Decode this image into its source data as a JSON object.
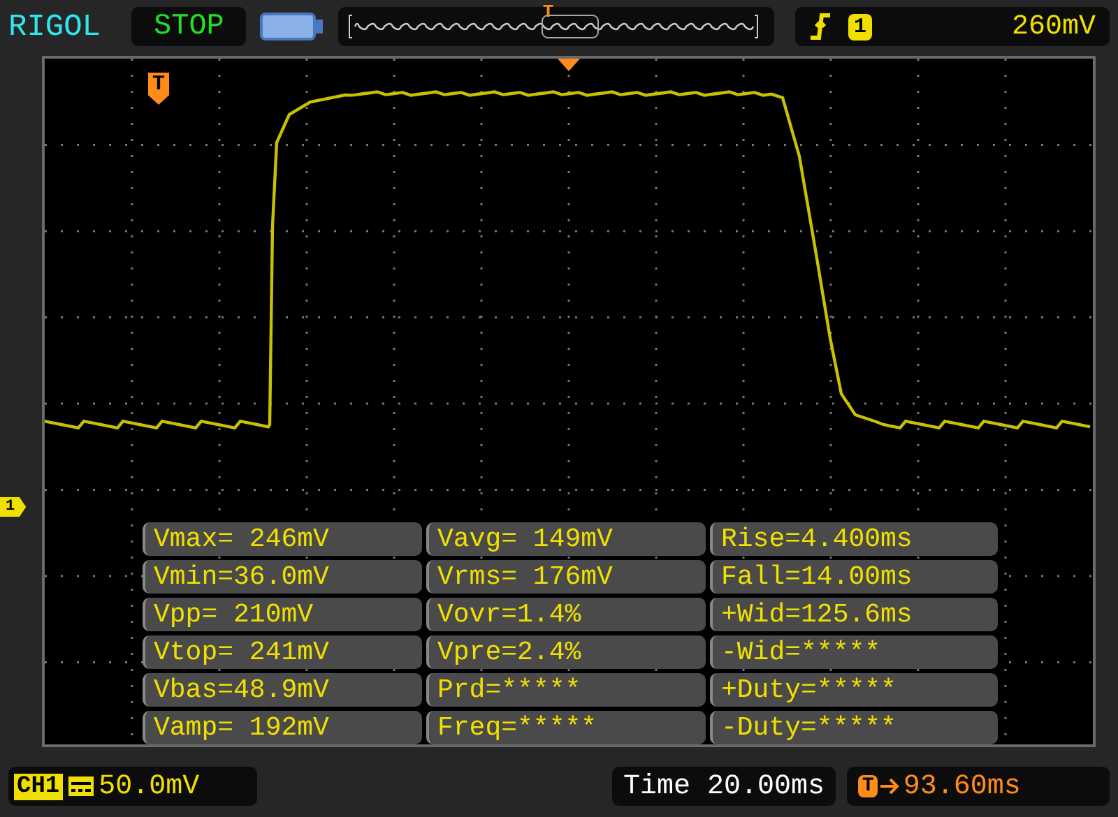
{
  "top_bar": {
    "brand": "RIGOL",
    "run_state": "STOP",
    "memory_marker": "T",
    "trigger": {
      "source": "1",
      "level": "260mV"
    }
  },
  "display": {
    "trigger_marker": "T",
    "channel_marker": "1",
    "measurements": [
      [
        "Vmax= 246mV",
        "Vavg= 149mV",
        "Rise=4.400ms"
      ],
      [
        "Vmin=36.0mV",
        "Vrms= 176mV",
        "Fall=14.00ms"
      ],
      [
        "Vpp= 210mV",
        "Vovr=1.4%",
        "+Wid=125.6ms"
      ],
      [
        "Vtop= 241mV",
        "Vpre=2.4%",
        "-Wid=*****"
      ],
      [
        "Vbas=48.9mV",
        "Prd=*****",
        "+Duty=*****"
      ],
      [
        "Vamp= 192mV",
        "Freq=*****",
        "-Duty=*****"
      ]
    ]
  },
  "bottom_bar": {
    "channel": "CH1",
    "scale": "50.0mV",
    "timebase": "Time 20.00ms",
    "offset_marker": "T",
    "trigger_offset": "93.60ms"
  }
}
